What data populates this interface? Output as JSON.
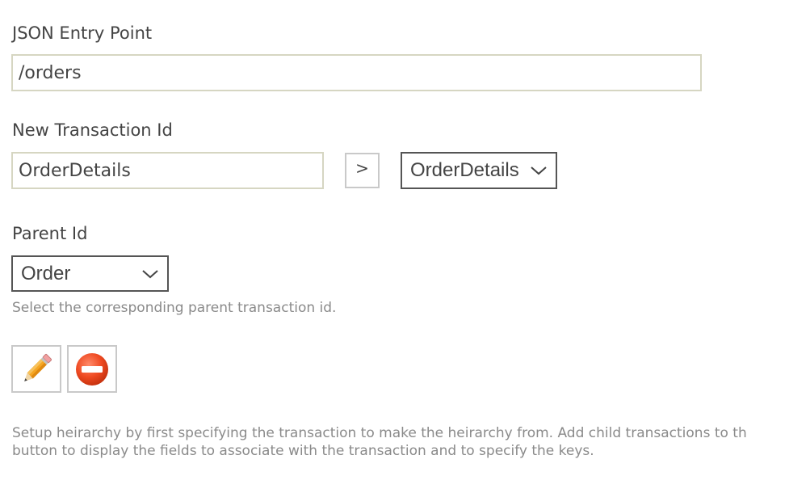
{
  "entry_point": {
    "label": "JSON Entry Point",
    "value": "/orders"
  },
  "transaction": {
    "label": "New Transaction Id",
    "value": "OrderDetails",
    "arrow_label": ">",
    "selected": "OrderDetails"
  },
  "parent": {
    "label": "Parent Id",
    "selected": "Order",
    "hint": "Select the corresponding parent transaction id."
  },
  "actions": {
    "edit_icon": "pencil-icon",
    "delete_icon": "no-entry-icon"
  },
  "description": {
    "line1": "Setup heirarchy by first specifying the transaction to make the heirarchy from. Add child transactions to th",
    "line2": "button to display the fields to associate with the transaction and to specify the keys."
  }
}
